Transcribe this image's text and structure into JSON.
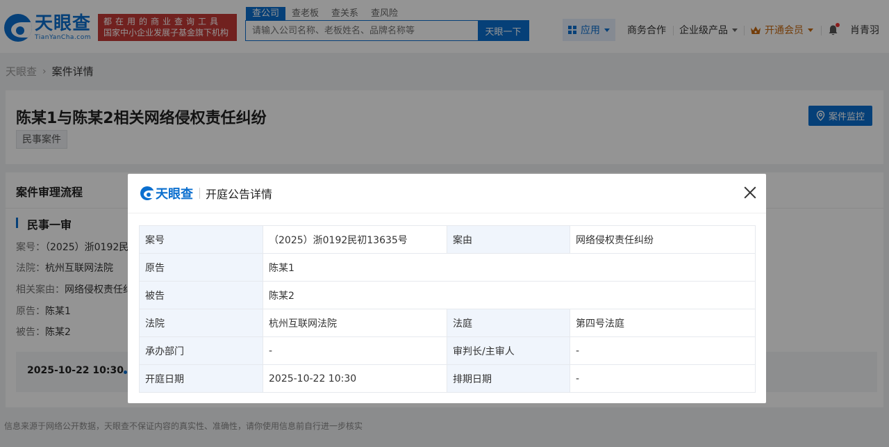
{
  "header": {
    "logo_cn": "天眼查",
    "logo_en": "TianYanCha.com",
    "slogan_line1": "都在用的商业查询工具",
    "slogan_line2": "国家中小企业发展子基金旗下机构",
    "search_tabs": [
      "查公司",
      "查老板",
      "查关系",
      "查风险"
    ],
    "search_placeholder": "请输入公司名称、老板姓名、品牌名称等",
    "search_button": "天眼一下",
    "nav": {
      "apps": "应用",
      "business": "商务合作",
      "enterprise": "企业级产品",
      "vip": "开通会员",
      "user": "肖青羽"
    }
  },
  "breadcrumb": {
    "home": "天眼查",
    "current": "案件详情"
  },
  "case": {
    "title": "陈某1与陈某2相关网络侵权责任纠纷",
    "tag": "民事案件",
    "monitor_button": "案件监控"
  },
  "flow": {
    "title": "案件审理流程",
    "stage": "民事一审",
    "rows": [
      {
        "label": "案号：",
        "value": "（2025）浙0192民"
      },
      {
        "label": "法院：",
        "value": "杭州互联网法院"
      },
      {
        "label": "相关案由：",
        "value": "网络侵权责任纠"
      },
      {
        "label": "原告：",
        "value": "陈某1"
      },
      {
        "label": "被告：",
        "value": "陈某2"
      }
    ],
    "time": "2025-10-22 10:30"
  },
  "footer_note": "信息来源于网络公开数据，天眼查不保证内容的真实性、准确性，请你使用信息前自行进一步核实",
  "modal": {
    "logo_text": "天眼查",
    "title": "开庭公告详情",
    "rows": [
      {
        "k1": "案号",
        "v1": "（2025）浙0192民初13635号",
        "k2": "案由",
        "v2": "网络侵权责任纠纷"
      },
      {
        "k1": "原告",
        "v1": "陈某1"
      },
      {
        "k1": "被告",
        "v1": "陈某2"
      },
      {
        "k1": "法院",
        "v1": "杭州互联网法院",
        "k2": "法庭",
        "v2": "第四号法庭"
      },
      {
        "k1": "承办部门",
        "v1": "-",
        "k2": "审判长/主审人",
        "v2": "-"
      },
      {
        "k1": "开庭日期",
        "v1": "2025-10-22 10:30",
        "k2": "排期日期",
        "v2": "-"
      }
    ]
  },
  "colors": {
    "brand": "#0b6fcf",
    "slogan_bg": "#c33a36",
    "vip": "#c76a12"
  }
}
